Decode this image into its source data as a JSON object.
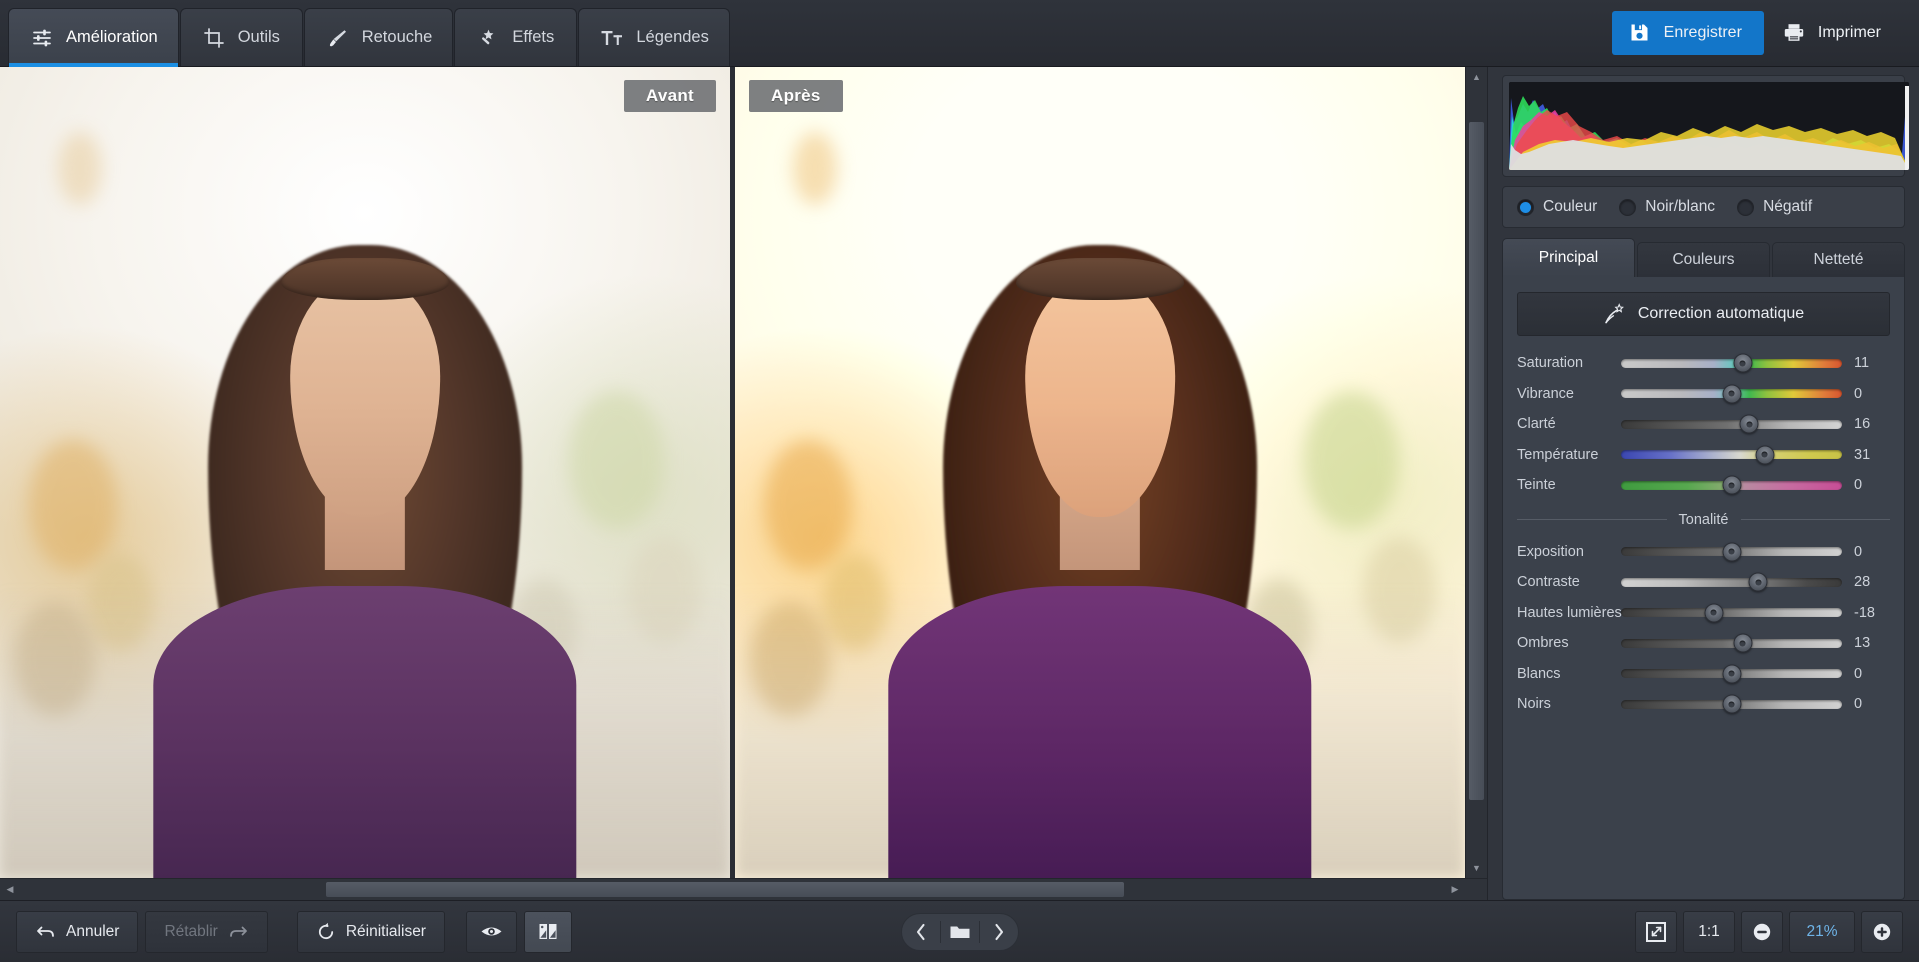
{
  "toolbar": {
    "tabs": [
      {
        "label": "Amélioration",
        "icon": "sliders-icon",
        "active": true
      },
      {
        "label": "Outils",
        "icon": "crop-icon",
        "active": false
      },
      {
        "label": "Retouche",
        "icon": "brush-icon",
        "active": false
      },
      {
        "label": "Effets",
        "icon": "magic-wand-icon",
        "active": false
      },
      {
        "label": "Légendes",
        "icon": "text-icon",
        "active": false
      }
    ],
    "save_label": "Enregistrer",
    "save_icon": "floppy-disk-icon",
    "print_label": "Imprimer",
    "print_icon": "printer-icon",
    "accent_color": "#1376c9"
  },
  "canvas": {
    "before_label": "Avant",
    "after_label": "Après"
  },
  "panel": {
    "histogram_label": "histogram",
    "modes": [
      {
        "label": "Couleur",
        "selected": true
      },
      {
        "label": "Noir/blanc",
        "selected": false
      },
      {
        "label": "Négatif",
        "selected": false
      }
    ],
    "tabs": [
      {
        "label": "Principal",
        "active": true
      },
      {
        "label": "Couleurs",
        "active": false
      },
      {
        "label": "Netteté",
        "active": false
      }
    ],
    "auto_button": {
      "label": "Correction automatique",
      "icon": "magic-auto-icon"
    },
    "sliders_main": [
      {
        "label": "Saturation",
        "value": "11",
        "pos": 55,
        "gradient": "saturation"
      },
      {
        "label": "Vibrance",
        "value": "0",
        "pos": 50,
        "gradient": "saturation"
      },
      {
        "label": "Clarté",
        "value": "16",
        "pos": 58,
        "gradient": "dark-light"
      },
      {
        "label": "Température",
        "value": "31",
        "pos": 65,
        "gradient": "temperature"
      },
      {
        "label": "Teinte",
        "value": "0",
        "pos": 50,
        "gradient": "tint"
      }
    ],
    "section_tonality": "Tonalité",
    "sliders_tonality": [
      {
        "label": "Exposition",
        "value": "0",
        "pos": 50,
        "gradient": "dark-light"
      },
      {
        "label": "Contraste",
        "value": "28",
        "pos": 62,
        "gradient": "light-dark"
      },
      {
        "label": "Hautes lumières",
        "value": "-18",
        "pos": 42,
        "gradient": "dark-light"
      },
      {
        "label": "Ombres",
        "value": "13",
        "pos": 55,
        "gradient": "dark-light"
      },
      {
        "label": "Blancs",
        "value": "0",
        "pos": 50,
        "gradient": "dark-light"
      },
      {
        "label": "Noirs",
        "value": "0",
        "pos": 50,
        "gradient": "dark-light"
      }
    ]
  },
  "bottombar": {
    "undo_label": "Annuler",
    "undo_icon": "undo-arrow-icon",
    "redo_label": "Rétablir",
    "redo_icon": "redo-arrow-icon",
    "redo_disabled": true,
    "reset_label": "Réinitialiser",
    "reset_icon": "reset-circle-icon",
    "preview_icon": "eye-icon",
    "compare_icon": "split-compare-icon",
    "prev_icon": "chevron-left-icon",
    "folder_icon": "folder-icon",
    "next_icon": "chevron-right-icon",
    "fit_icon": "fit-to-screen-icon",
    "actual_size_label": "1:1",
    "zoom_out_icon": "minus-circle-icon",
    "zoom_value": "21%",
    "zoom_in_icon": "plus-circle-icon",
    "zoom_value_color": "#6fb4e8"
  }
}
